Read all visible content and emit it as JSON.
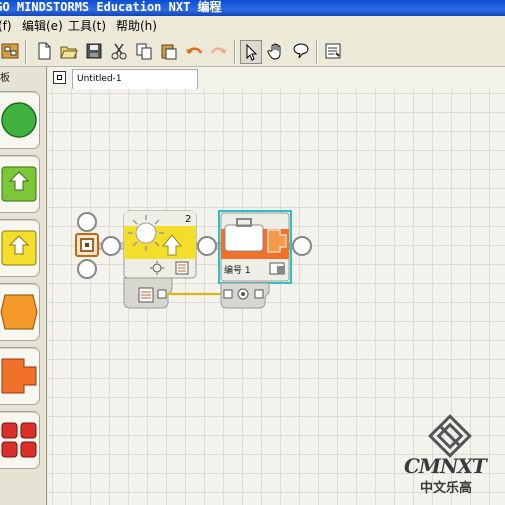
{
  "window": {
    "title": "EGO MINDSTORMS Education NXT 编程"
  },
  "menu": {
    "items": [
      "(f) 文件(f)",
      "编辑(e)",
      "工具(t)",
      "帮助(h)"
    ],
    "first_partial": "(f)"
  },
  "palette": {
    "title": "板"
  },
  "tabs": [
    {
      "label": "Untitled-1"
    }
  ],
  "blocks": {
    "light_sensor": {
      "port": "2"
    },
    "file_access": {
      "label": "编号 1"
    }
  },
  "watermark": {
    "logo_text": "CMNXT",
    "subtitle": "中文乐高"
  },
  "colors": {
    "title_bar": "#0a4fd0",
    "canvas": "#f3f2ec",
    "sensor_yellow": "#f4de2c",
    "action_orange": "#f0722a",
    "selection": "#2cc2c2",
    "wire": "#f0b000"
  }
}
